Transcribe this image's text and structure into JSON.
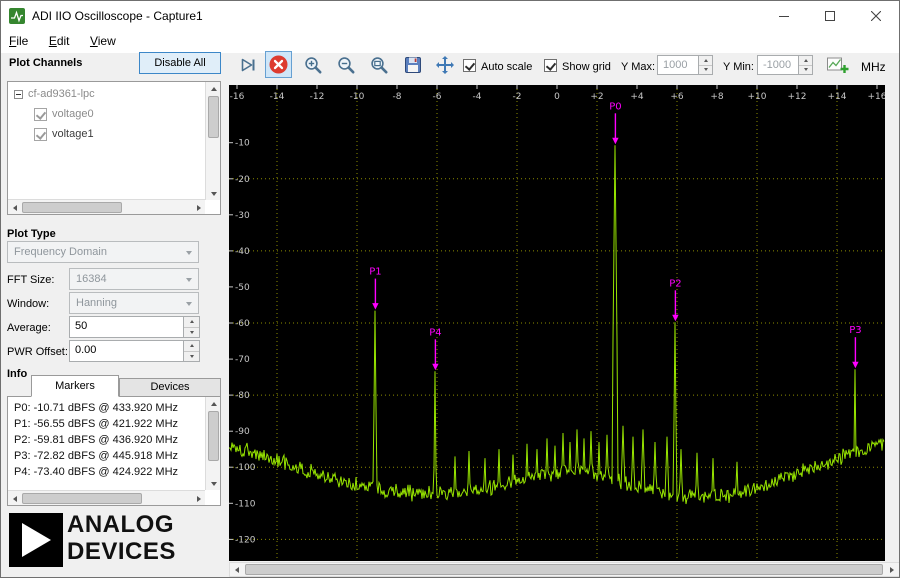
{
  "window": {
    "title": "ADI IIO Oscilloscope - Capture1"
  },
  "menu": {
    "items": [
      {
        "label": "File"
      },
      {
        "label": "Edit"
      },
      {
        "label": "View"
      }
    ]
  },
  "left_panel": {
    "plot_channels_label": "Plot Channels",
    "disable_all_button": "Disable All",
    "device_tree": {
      "device": "cf-ad9361-lpc",
      "channels": [
        {
          "label": "voltage0",
          "checked": true
        },
        {
          "label": "voltage1",
          "checked": true
        }
      ]
    },
    "plot_type_label": "Plot Type",
    "plot_type_value": "Frequency Domain",
    "fft_size_label": "FFT Size:",
    "fft_size_value": "16384",
    "window_label": "Window:",
    "window_value": "Hanning",
    "average_label": "Average:",
    "average_value": "50",
    "pwr_offset_label": "PWR Offset:",
    "pwr_offset_value": "0.00",
    "info_label": "Info",
    "tabs": [
      {
        "label": "Markers"
      },
      {
        "label": "Devices"
      }
    ],
    "markers": [
      "P0: -10.71 dBFS @ 433.920 MHz",
      "P1: -56.55 dBFS @ 421.922 MHz",
      "P2: -59.81 dBFS @ 436.920 MHz",
      "P3: -72.82 dBFS @ 445.918 MHz",
      "P4: -73.40 dBFS @ 424.922 MHz"
    ],
    "logo": {
      "line1": "ANALOG",
      "line2": "DEVICES"
    }
  },
  "toolbar": {
    "auto_scale_label": "Auto scale",
    "auto_scale_checked": true,
    "show_grid_label": "Show grid",
    "show_grid_checked": true,
    "y_max_label": "Y Max:",
    "y_max_value": "1000",
    "y_min_label": "Y Min:",
    "y_min_value": "-1000",
    "unit_label": "MHz"
  },
  "chart_data": {
    "type": "line",
    "title": "",
    "xlabel": "MHz",
    "ylabel": "dBFS",
    "xlim": [
      -16.4,
      16.4
    ],
    "ylim": [
      -126,
      6
    ],
    "grid": true,
    "x_ticks": [
      {
        "v": -16,
        "label": "-16"
      },
      {
        "v": -14,
        "label": "-14"
      },
      {
        "v": -12,
        "label": "-12"
      },
      {
        "v": -10,
        "label": "-10"
      },
      {
        "v": -8,
        "label": "-8"
      },
      {
        "v": -6,
        "label": "-6"
      },
      {
        "v": -4,
        "label": "-4"
      },
      {
        "v": -2,
        "label": "-2"
      },
      {
        "v": 0,
        "label": "0"
      },
      {
        "v": 2,
        "label": "+2"
      },
      {
        "v": 4,
        "label": "+4"
      },
      {
        "v": 6,
        "label": "+6"
      },
      {
        "v": 8,
        "label": "+8"
      },
      {
        "v": 10,
        "label": "+10"
      },
      {
        "v": 12,
        "label": "+12"
      },
      {
        "v": 14,
        "label": "+14"
      },
      {
        "v": 16,
        "label": "+16"
      }
    ],
    "y_ticks": [
      -10,
      -20,
      -30,
      -40,
      -50,
      -60,
      -70,
      -80,
      -90,
      -100,
      -110,
      -120
    ],
    "x_grid": [
      -14,
      -10,
      -6,
      -2,
      2,
      6,
      10,
      14
    ],
    "y_grid": [
      -20,
      -40,
      -60,
      -80,
      -100,
      -120
    ],
    "colors": {
      "bg": "#000000",
      "grid": "#8C8C00",
      "trace": "#97E400",
      "marker": "#FF00FF",
      "axis_text": "#C8C8C8"
    },
    "noise_db": 2.2,
    "noise_floor": [
      [
        -16.4,
        -94.5
      ],
      [
        -14,
        -98
      ],
      [
        -12,
        -102
      ],
      [
        -10,
        -105
      ],
      [
        -8,
        -106.8
      ],
      [
        -6,
        -107.4
      ],
      [
        -4,
        -106.5
      ],
      [
        -3,
        -105.2
      ],
      [
        -2,
        -103.5
      ],
      [
        -1,
        -102.2
      ],
      [
        0,
        -101.4
      ],
      [
        0.7,
        -101.2
      ],
      [
        1.5,
        -102
      ],
      [
        2.5,
        -103.2
      ],
      [
        3.5,
        -104.8
      ],
      [
        4.5,
        -106.2
      ],
      [
        5.5,
        -107.2
      ],
      [
        6.5,
        -108
      ],
      [
        7.5,
        -108.2
      ],
      [
        8.5,
        -107.6
      ],
      [
        9.5,
        -106.4
      ],
      [
        10.5,
        -104.8
      ],
      [
        12,
        -101.6
      ],
      [
        13.5,
        -98.5
      ],
      [
        15,
        -95.8
      ],
      [
        16.4,
        -93.2
      ]
    ],
    "spurs": [
      [
        -5.1,
        -97
      ],
      [
        -4.4,
        -95.5
      ],
      [
        -3.6,
        -97.5
      ],
      [
        -2.9,
        -95
      ],
      [
        -2.2,
        -96.5
      ],
      [
        -1.5,
        -93.5
      ],
      [
        -1,
        -95
      ],
      [
        -0.5,
        -92
      ],
      [
        -0.1,
        -94
      ],
      [
        0.3,
        -90.5
      ],
      [
        0.65,
        -93
      ],
      [
        1,
        -89.5
      ],
      [
        1.35,
        -92
      ],
      [
        1.7,
        -90
      ],
      [
        2.1,
        -93
      ],
      [
        2.5,
        -91
      ],
      [
        3.3,
        -88.5
      ],
      [
        3.8,
        -91.5
      ],
      [
        4.3,
        -89.5
      ],
      [
        4.9,
        -93
      ],
      [
        5.5,
        -91.5
      ],
      [
        6.2,
        -95
      ],
      [
        7,
        -96
      ],
      [
        7.8,
        -97.5
      ],
      [
        9,
        -98.5
      ]
    ],
    "peaks": [
      {
        "name": "P0",
        "x": 2.92,
        "db": -10.71,
        "freq_mhz": "433.920"
      },
      {
        "name": "P1",
        "x": -9.08,
        "db": -56.55,
        "freq_mhz": "421.922"
      },
      {
        "name": "P2",
        "x": 5.92,
        "db": -59.81,
        "freq_mhz": "436.920"
      },
      {
        "name": "P3",
        "x": 14.92,
        "db": -72.82,
        "freq_mhz": "445.918"
      },
      {
        "name": "P4",
        "x": -6.08,
        "db": -73.4,
        "freq_mhz": "424.922"
      }
    ]
  }
}
